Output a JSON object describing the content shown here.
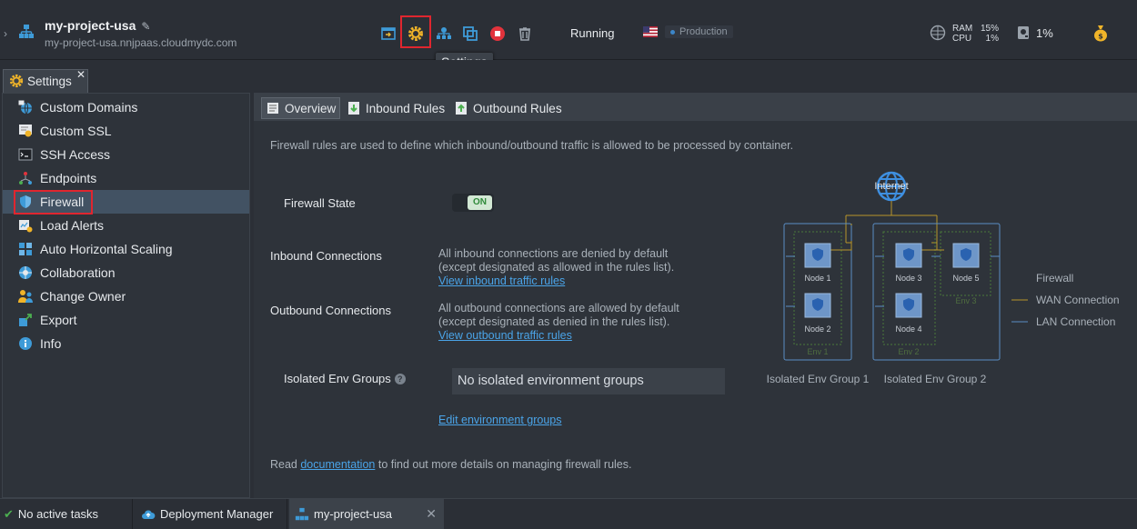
{
  "env": {
    "name": "my-project-usa",
    "url": "my-project-usa.nnjpaas.cloudmydc.com",
    "status": "Running",
    "tag": "Production",
    "tooltip": "Settings",
    "metrics": {
      "ram_label": "RAM",
      "cpu_label": "CPU",
      "ram_value": "15%",
      "cpu_value": "1%",
      "disk_value": "1%"
    }
  },
  "panel_tab": {
    "label": "Settings"
  },
  "sidebar": {
    "items": [
      {
        "label": "Custom Domains",
        "icon": "custom-domains-icon"
      },
      {
        "label": "Custom SSL",
        "icon": "ssl-certificate-icon"
      },
      {
        "label": "SSH Access",
        "icon": "terminal-icon"
      },
      {
        "label": "Endpoints",
        "icon": "endpoints-icon"
      },
      {
        "label": "Firewall",
        "icon": "shield-icon"
      },
      {
        "label": "Load Alerts",
        "icon": "load-alerts-icon"
      },
      {
        "label": "Auto Horizontal Scaling",
        "icon": "scaling-icon"
      },
      {
        "label": "Collaboration",
        "icon": "collaboration-icon"
      },
      {
        "label": "Change Owner",
        "icon": "change-owner-icon"
      },
      {
        "label": "Export",
        "icon": "export-icon"
      },
      {
        "label": "Info",
        "icon": "info-icon"
      }
    ],
    "active_index": 4
  },
  "tabs": [
    {
      "label": "Overview"
    },
    {
      "label": "Inbound Rules"
    },
    {
      "label": "Outbound Rules"
    }
  ],
  "overview": {
    "intro": "Firewall rules are used to define which inbound/outbound traffic is allowed to be processed by container.",
    "firewall_state_label": "Firewall State",
    "toggle_text": "ON",
    "inbound_label": "Inbound Connections",
    "inbound_desc_1": "All inbound connections are denied by default",
    "inbound_desc_2": "(except designated as allowed in the rules list).",
    "inbound_link": "View inbound traffic rules",
    "outbound_label": "Outbound Connections",
    "outbound_desc_1": "All outbound connections are allowed by default",
    "outbound_desc_2": "(except designated as denied in the rules list).",
    "outbound_link": "View outbound traffic rules",
    "isolated_label": "Isolated Env Groups",
    "isolated_value": "No isolated environment groups",
    "edit_groups_link": "Edit environment groups",
    "footer_prefix": "Read ",
    "footer_link": "documentation",
    "footer_suffix": " to find out more details on managing firewall rules."
  },
  "diagram": {
    "internet": "Internet",
    "nodes": [
      "Node 1",
      "Node 2",
      "Node 3",
      "Node 4",
      "Node 5"
    ],
    "envs": [
      "Env 1",
      "Env 2",
      "Env 3"
    ],
    "groups": [
      "Isolated Env Group 1",
      "Isolated Env Group 2"
    ],
    "legend": {
      "firewall": "Firewall",
      "wan": "WAN Connection",
      "lan": "LAN Connection"
    },
    "colors": {
      "wan": "#b8962a",
      "lan": "#5a8ec4",
      "env_border": "#4a7a3a",
      "node": "#6e96c8"
    }
  },
  "taskbar": {
    "tasks_status": "No active tasks",
    "deployment_manager": "Deployment Manager",
    "env_tab": "my-project-usa"
  }
}
